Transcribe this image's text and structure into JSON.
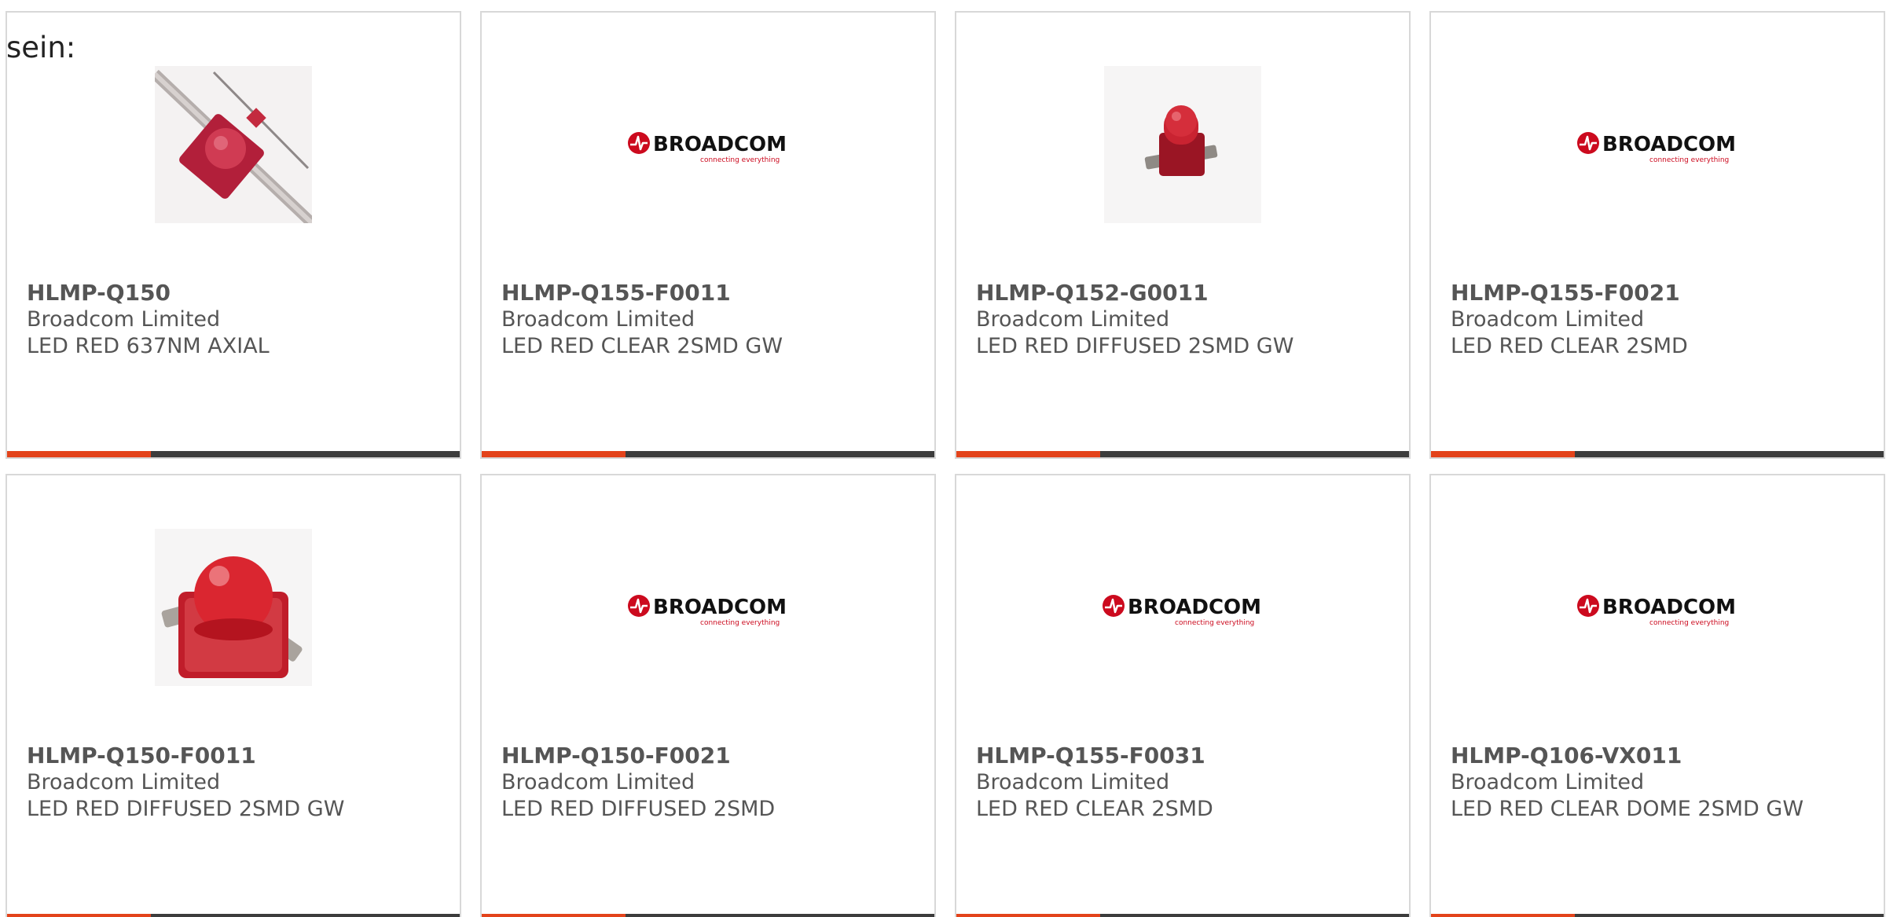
{
  "intro_text": "sein:",
  "colors": {
    "accent": "#e3431b",
    "bar_dark": "#3c3c3c",
    "text": "#555555",
    "border": "#d8d8d8",
    "broadcom_red": "#cc0a1e"
  },
  "logo": {
    "brand": "BROADCOM",
    "tagline": "connecting everything"
  },
  "products": [
    {
      "part_number": "HLMP-Q150",
      "manufacturer": "Broadcom Limited",
      "description": "LED RED 637NM AXIAL",
      "image": "led-axial-photo"
    },
    {
      "part_number": "HLMP-Q155-F0011",
      "manufacturer": "Broadcom Limited",
      "description": "LED RED CLEAR 2SMD GW",
      "image": "broadcom-logo"
    },
    {
      "part_number": "HLMP-Q152-G0011",
      "manufacturer": "Broadcom Limited",
      "description": "LED RED DIFFUSED 2SMD GW",
      "image": "led-smd-small-photo"
    },
    {
      "part_number": "HLMP-Q155-F0021",
      "manufacturer": "Broadcom Limited",
      "description": "LED RED CLEAR 2SMD",
      "image": "broadcom-logo"
    },
    {
      "part_number": "HLMP-Q150-F0011",
      "manufacturer": "Broadcom Limited",
      "description": "LED RED DIFFUSED 2SMD GW",
      "image": "led-smd-large-photo"
    },
    {
      "part_number": "HLMP-Q150-F0021",
      "manufacturer": "Broadcom Limited",
      "description": "LED RED DIFFUSED 2SMD",
      "image": "broadcom-logo"
    },
    {
      "part_number": "HLMP-Q155-F0031",
      "manufacturer": "Broadcom Limited",
      "description": "LED RED CLEAR 2SMD",
      "image": "broadcom-logo"
    },
    {
      "part_number": "HLMP-Q106-VX011",
      "manufacturer": "Broadcom Limited",
      "description": "LED RED CLEAR DOME 2SMD GW",
      "image": "broadcom-logo"
    }
  ]
}
